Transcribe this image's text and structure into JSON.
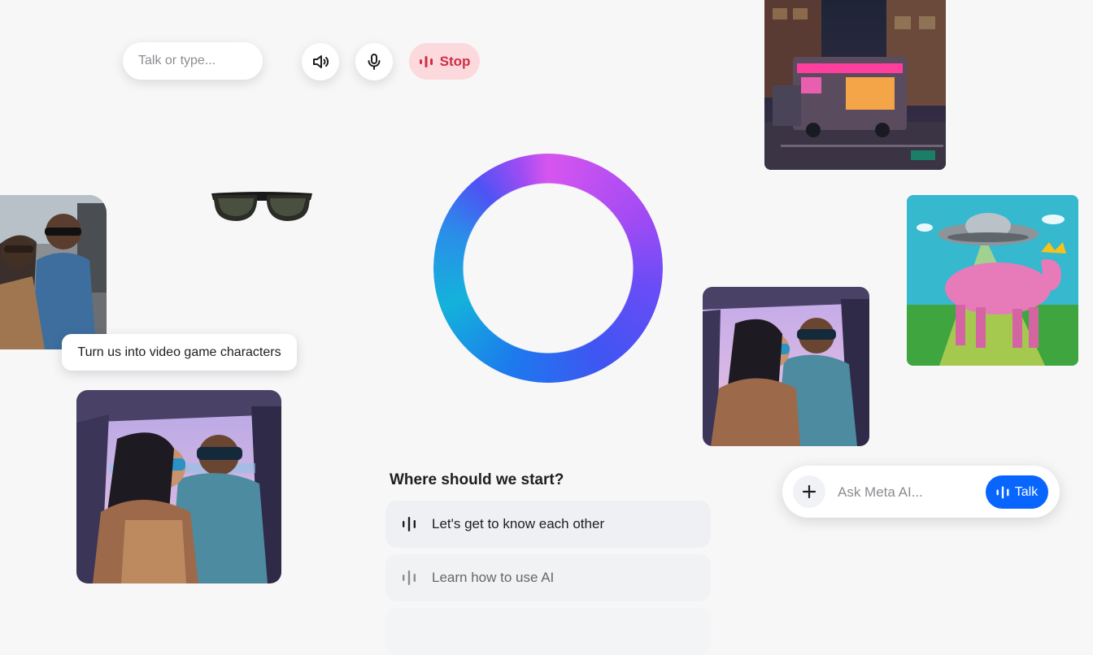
{
  "toolbar": {
    "input_placeholder": "Talk or type...",
    "speaker_icon": "speaker-icon",
    "mic_icon": "microphone-icon",
    "stop_label": "Stop"
  },
  "caption": {
    "text": "Turn us into video game characters"
  },
  "prompts": {
    "title": "Where should we start?",
    "items": [
      {
        "label": "Let's get to know each other"
      },
      {
        "label": "Learn how to use AI"
      }
    ]
  },
  "ask_bar": {
    "placeholder": "Ask Meta AI...",
    "talk_label": "Talk"
  },
  "colors": {
    "accent": "#0866ff",
    "stop_bg": "#fcd9dc",
    "stop_text": "#d12d45"
  }
}
